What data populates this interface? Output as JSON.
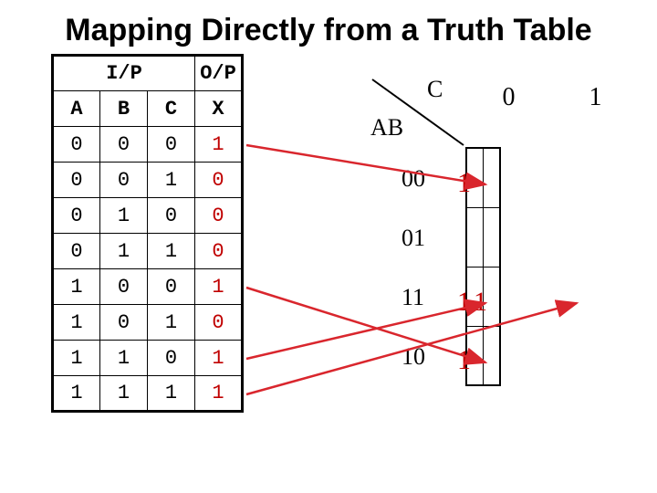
{
  "title": "Mapping Directly from a Truth Table",
  "truth_table": {
    "section_headers": {
      "input": "I/P",
      "output": "O/P"
    },
    "columns": [
      "A",
      "B",
      "C",
      "X"
    ],
    "rows": [
      {
        "A": "0",
        "B": "0",
        "C": "0",
        "X": "1"
      },
      {
        "A": "0",
        "B": "0",
        "C": "1",
        "X": "0"
      },
      {
        "A": "0",
        "B": "1",
        "C": "0",
        "X": "0"
      },
      {
        "A": "0",
        "B": "1",
        "C": "1",
        "X": "0"
      },
      {
        "A": "1",
        "B": "0",
        "C": "0",
        "X": "1"
      },
      {
        "A": "1",
        "B": "0",
        "C": "1",
        "X": "0"
      },
      {
        "A": "1",
        "B": "1",
        "C": "0",
        "X": "1"
      },
      {
        "A": "1",
        "B": "1",
        "C": "1",
        "X": "1"
      }
    ]
  },
  "kmap": {
    "col_var": "C",
    "row_var": "AB",
    "col_headers": [
      "0",
      "1"
    ],
    "row_headers": [
      "00",
      "01",
      "11",
      "10"
    ],
    "cells": [
      [
        "1",
        ""
      ],
      [
        "",
        ""
      ],
      [
        "1",
        "1"
      ],
      [
        "1",
        ""
      ]
    ]
  },
  "colors": {
    "output_red": "#c00000",
    "arrow_red": "#d9262d"
  }
}
